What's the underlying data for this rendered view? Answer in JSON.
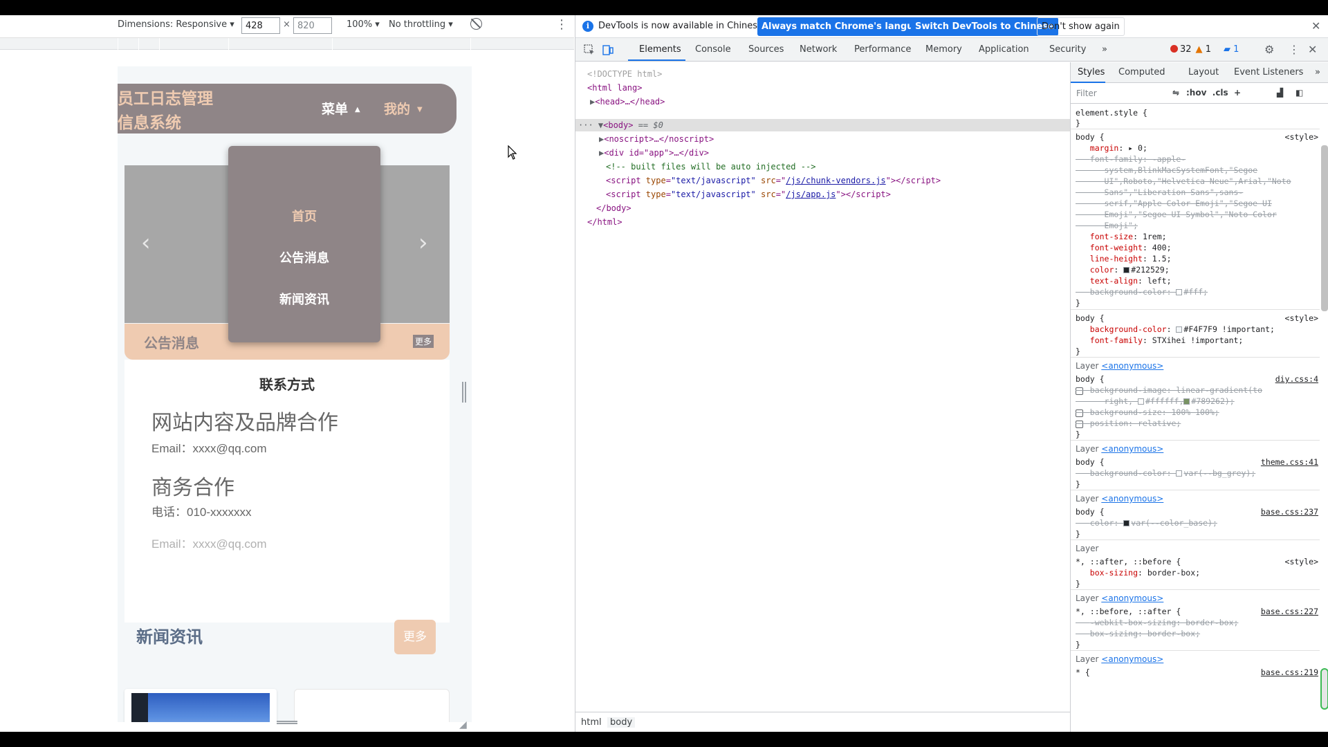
{
  "emulation": {
    "dimensions_label": "Dimensions: Responsive ▾",
    "width": "428",
    "times": "×",
    "height": "820",
    "zoom": "100% ▾",
    "throttling": "No throttling ▾",
    "more": "⋮"
  },
  "app": {
    "title": "员工日志管理信息系统",
    "nav_menu": "菜单",
    "nav_mine": "我的",
    "menu_items": [
      "首页",
      "公告消息",
      "新闻资讯"
    ],
    "notice_title": "公告消息",
    "notice_more": "更多",
    "contact": {
      "heading": "联系方式",
      "section1_title": "网站内容及品牌合作",
      "section1_email": "Email：xxxx@qq.com",
      "section2_title": "商务合作",
      "section2_phone": "电话：010-xxxxxxx",
      "section2_email": "Email：xxxx@qq.com"
    },
    "news_title": "新闻资讯",
    "news_more": "更多"
  },
  "devtools": {
    "infobar": {
      "text": "DevTools is now available in Chinese!",
      "btn_match": "Always match Chrome's language",
      "btn_switch": "Switch DevTools to Chinese",
      "btn_dismiss": "Don't show again"
    },
    "tabs": [
      "Elements",
      "Console",
      "Sources",
      "Network",
      "Performance",
      "Memory",
      "Application",
      "Security"
    ],
    "more_tabs": "»",
    "errors": "32",
    "warnings": "1",
    "messages": "1",
    "breadcrumb": [
      "html",
      "body"
    ],
    "styles_tabs": [
      "Styles",
      "Computed",
      "Layout",
      "Event Listeners"
    ],
    "filter_placeholder": "Filter",
    "filter_tools": ":hov  .cls  +",
    "dom": {
      "doctype": "<!DOCTYPE html>",
      "html_open": "<html lang>",
      "head": "<head>…</head>",
      "body_open": "<body>",
      "body_eq": " == $0",
      "noscript": "<noscript>…</noscript>",
      "div_app": "<div id=\"app\">…</div>",
      "comment": "<!-- built files will be auto injected -->",
      "script1_src": "/js/chunk-vendors.js",
      "script2_src": "/js/app.js",
      "body_close": "</body>",
      "html_close": "</html>"
    }
  }
}
